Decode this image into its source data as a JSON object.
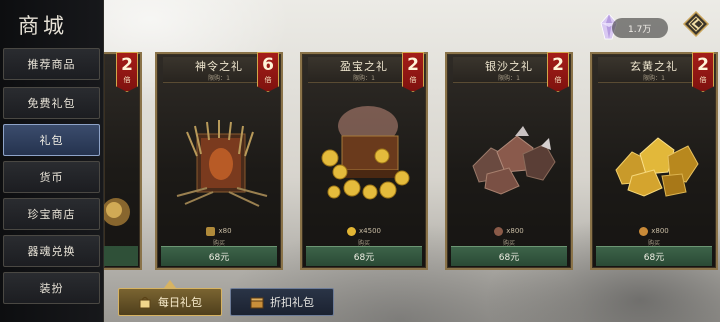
{
  "shop": {
    "title": "商城"
  },
  "sidebar": {
    "items": [
      {
        "label": "推荐商品",
        "active": false
      },
      {
        "label": "免费礼包",
        "active": false
      },
      {
        "label": "礼包",
        "active": true
      },
      {
        "label": "货币",
        "active": false
      },
      {
        "label": "珍宝商店",
        "active": false
      },
      {
        "label": "器魂兑换",
        "active": false
      },
      {
        "label": "装扮",
        "active": false
      }
    ]
  },
  "currency": {
    "amount": "1.7万",
    "icon": "crystal-icon"
  },
  "cards": [
    {
      "title": "",
      "limit": "",
      "multiplier": "2",
      "multiplier_unit": "倍",
      "quantity": "",
      "buy_label": "",
      "price": "",
      "art": "partial"
    },
    {
      "title": "神令之礼",
      "limit": "限购：1",
      "multiplier": "6",
      "multiplier_unit": "倍",
      "quantity": "x80",
      "buy_label": "购买",
      "price": "68元",
      "art": "token-bundle"
    },
    {
      "title": "盈宝之礼",
      "limit": "限购：1",
      "multiplier": "2",
      "multiplier_unit": "倍",
      "quantity": "x4500",
      "buy_label": "购买",
      "price": "68元",
      "art": "treasure-chest"
    },
    {
      "title": "银沙之礼",
      "limit": "限购：1",
      "multiplier": "2",
      "multiplier_unit": "倍",
      "quantity": "x800",
      "buy_label": "购买",
      "price": "68元",
      "art": "ore-pile"
    },
    {
      "title": "玄黄之礼",
      "limit": "限购：1",
      "multiplier": "2",
      "multiplier_unit": "倍",
      "quantity": "x800",
      "buy_label": "购买",
      "price": "68元",
      "art": "gold-pile"
    }
  ],
  "bottom_tabs": [
    {
      "label": "每日礼包",
      "active": true
    },
    {
      "label": "折扣礼包",
      "active": false
    }
  ],
  "colors": {
    "badge_red": "#a51d18",
    "price_green": "#3d6349",
    "card_border": "#8a7349",
    "active_nav": "#3b4c6c"
  }
}
